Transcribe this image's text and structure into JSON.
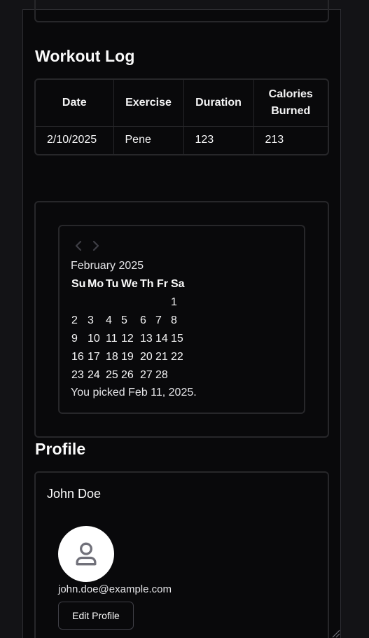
{
  "workout_log": {
    "title": "Workout Log",
    "columns": [
      "Date",
      "Exercise",
      "Duration",
      "Calories Burned"
    ],
    "rows": [
      [
        "2/10/2025",
        "Pene",
        "123",
        "213"
      ]
    ]
  },
  "calendar": {
    "prev_icon": "chevron-left-icon",
    "next_icon": "chevron-right-icon",
    "month_label": "February 2025",
    "weekdays": [
      "Su",
      "Mo",
      "Tu",
      "We",
      "Th",
      "Fr",
      "Sa"
    ],
    "weeks": [
      [
        "",
        "",
        "",
        "",
        "",
        "",
        "1"
      ],
      [
        "2",
        "3",
        "4",
        "5",
        "6",
        "7",
        "8"
      ],
      [
        "9",
        "10",
        "11",
        "12",
        "13",
        "14",
        "15"
      ],
      [
        "16",
        "17",
        "18",
        "19",
        "20",
        "21",
        "22"
      ],
      [
        "23",
        "24",
        "25",
        "26",
        "27",
        "28",
        ""
      ]
    ],
    "picked_text": "You picked Feb 11, 2025."
  },
  "profile": {
    "title": "Profile",
    "name": "John Doe",
    "avatar_icon": "user-icon",
    "email": "john.doe@example.com",
    "edit_label": "Edit Profile"
  }
}
